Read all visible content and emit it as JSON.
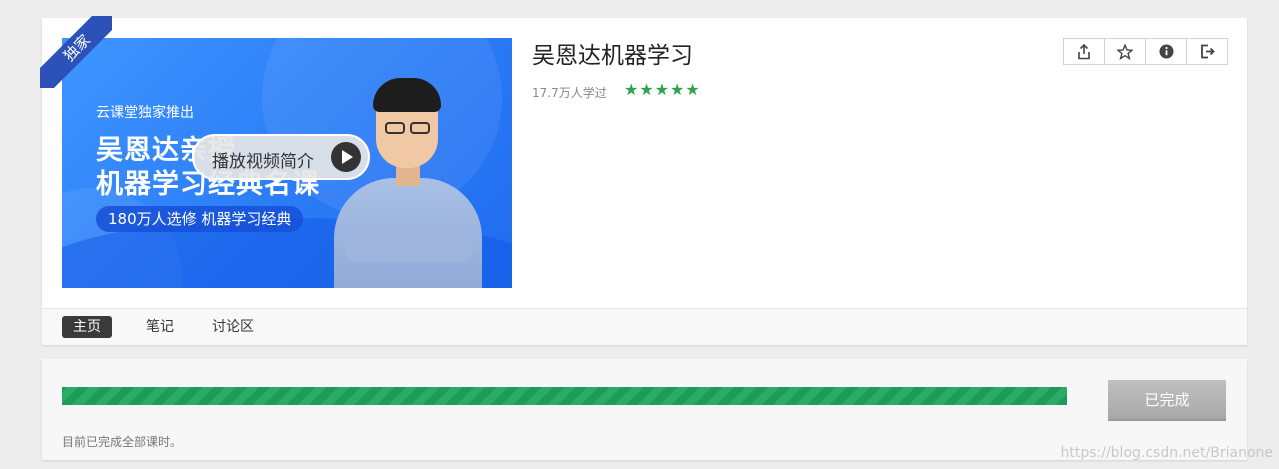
{
  "course": {
    "title": "吴恩达机器学习",
    "learners": "17.7万人学过",
    "rating": 5,
    "cover": {
      "subtitle": "云课堂独家推出",
      "title_line1": "吴恩达亲授",
      "title_line2": "机器学习经典名课",
      "pill": "180万人选修 机器学习经典",
      "play_label": "播放视频简介",
      "ribbon": "独家"
    }
  },
  "actions": [
    {
      "icon": "share-icon"
    },
    {
      "icon": "star-icon"
    },
    {
      "icon": "info-icon"
    },
    {
      "icon": "exit-icon"
    }
  ],
  "tabs": [
    "主页",
    "笔记",
    "讨论区"
  ],
  "active_tab": "主页",
  "progress": {
    "percent": 100,
    "button_label": "已完成",
    "status_text": "目前已完成全部课时。"
  },
  "watermark": "https://blog.csdn.net/Brianone",
  "colors": {
    "progress_green": "#1f9b58",
    "star_green": "#2fa34a",
    "ribbon_blue": "#2c51b8",
    "cover_blue": "#2b7cf6"
  }
}
